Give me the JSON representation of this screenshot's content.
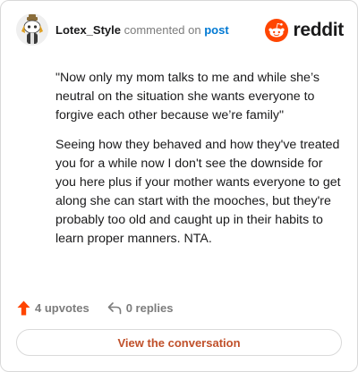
{
  "comment": {
    "username": "Lotex_Style",
    "action_text": "commented on",
    "post_link": "post",
    "paragraphs": [
      "\"Now only my mom talks to me and while she’s neutral on the situation she wants everyone to forgive each other because we’re family\"",
      "Seeing how they behaved and how they've treated you for a while now I don't see the downside for you here plus if your mother wants everyone to get along she can start with the mooches, but they're probably too old and caught up in their habits to learn proper manners. NTA."
    ]
  },
  "brand": {
    "name": "reddit",
    "logo_icon": "reddit-snoo-icon",
    "accent_color": "#ff4500"
  },
  "actions": {
    "upvotes": "4 upvotes",
    "replies": "0 replies",
    "upvote_icon": "upvote-arrow-icon",
    "reply_icon": "reply-arrow-icon",
    "upvote_color": "#ff4500"
  },
  "cta": {
    "label": "View the conversation"
  }
}
